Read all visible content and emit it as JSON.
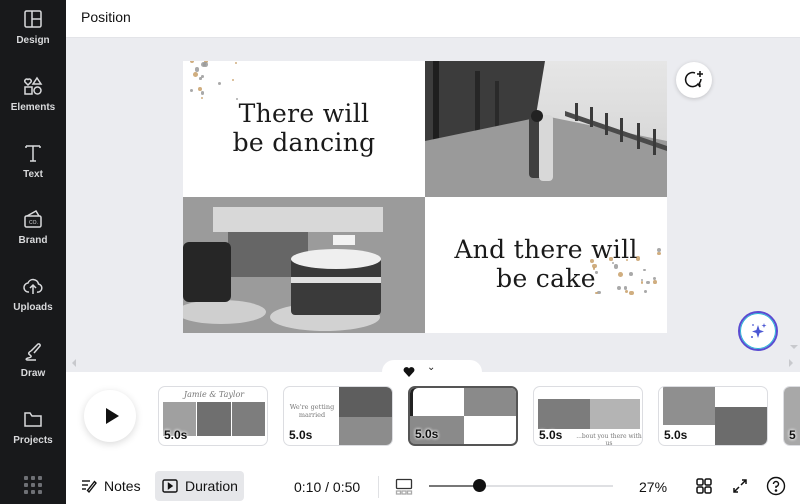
{
  "sidebar": {
    "items": [
      {
        "label": "Design",
        "icon": "layout-icon"
      },
      {
        "label": "Elements",
        "icon": "shapes-icon"
      },
      {
        "label": "Text",
        "icon": "text-icon"
      },
      {
        "label": "Brand",
        "icon": "brand-icon"
      },
      {
        "label": "Uploads",
        "icon": "cloud-upload-icon"
      },
      {
        "label": "Draw",
        "icon": "pen-icon"
      },
      {
        "label": "Projects",
        "icon": "folder-icon"
      }
    ],
    "apps_icon": "grid-icon"
  },
  "topbar": {
    "title": "Position"
  },
  "slide": {
    "text_top": "There will be dancing",
    "text_bottom": "And there will be cake",
    "images": [
      "couple-in-field-photo",
      "cake-photo"
    ],
    "confetti_colors": [
      "#c8a06a",
      "#9a9a9a"
    ]
  },
  "canvas_buttons": {
    "comment": "add-comment-icon",
    "magic": "magic-sparkle-icon"
  },
  "timeline": {
    "pages": [
      {
        "duration": "5.0s",
        "caption": "Jamie & Taylor",
        "active": false
      },
      {
        "duration": "5.0s",
        "caption": "We're getting married",
        "active": false
      },
      {
        "duration": "5.0s",
        "caption": "There will be dancing / And there will be cake",
        "active": true
      },
      {
        "duration": "5.0s",
        "caption": "...bout you there with us",
        "active": false
      },
      {
        "duration": "5.0s",
        "caption": "",
        "active": false
      },
      {
        "duration": "5",
        "caption": "",
        "active": false
      }
    ]
  },
  "bottombar": {
    "notes_label": "Notes",
    "duration_label": "Duration",
    "time": "0:10 / 0:50",
    "zoom_percent": "27%",
    "zoom_value": 0.27
  },
  "colors": {
    "sidebar_bg": "#18191b",
    "canvas_bg": "#ebecf0",
    "accent": "#5a4bd1"
  }
}
